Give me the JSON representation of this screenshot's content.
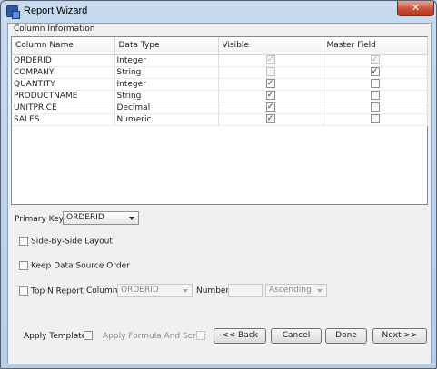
{
  "window": {
    "title": "Report Wizard",
    "close_glyph": "✕"
  },
  "column_info": {
    "group_label": "Column Information",
    "headers": [
      "Column Name",
      "Data Type",
      "Visible",
      "Master Field"
    ],
    "rows": [
      {
        "name": "ORDERID",
        "type": "Integer",
        "visible": true,
        "visible_enabled": false,
        "master": true,
        "master_enabled": false
      },
      {
        "name": "COMPANY",
        "type": "String",
        "visible": false,
        "visible_enabled": false,
        "master": true,
        "master_enabled": true
      },
      {
        "name": "QUANTITY",
        "type": "Integer",
        "visible": true,
        "visible_enabled": true,
        "master": false,
        "master_enabled": true
      },
      {
        "name": "PRODUCTNAME",
        "type": "String",
        "visible": true,
        "visible_enabled": true,
        "master": false,
        "master_enabled": true
      },
      {
        "name": "UNITPRICE",
        "type": "Decimal",
        "visible": true,
        "visible_enabled": true,
        "master": false,
        "master_enabled": true
      },
      {
        "name": "SALES",
        "type": "Numeric",
        "visible": true,
        "visible_enabled": true,
        "master": false,
        "master_enabled": true
      }
    ]
  },
  "primary_key": {
    "label": "Primary Key",
    "value": "ORDERID"
  },
  "side_by_side": {
    "label": "Side-By-Side Layout",
    "checked": false
  },
  "keep_order": {
    "label": "Keep Data Source Order",
    "checked": false
  },
  "top_n": {
    "label": "Top N Report",
    "checked": false,
    "column_label": "Column",
    "column_value": "ORDERID",
    "number_label": "Number",
    "number_value": "",
    "order_value": "Ascending"
  },
  "footer": {
    "apply_template_label": "Apply Template",
    "apply_formula_label": "Apply Formula And Script",
    "back_label": "<< Back",
    "cancel_label": "Cancel",
    "done_label": "Done",
    "next_label": "Next >>"
  },
  "check_glyph": "✓"
}
